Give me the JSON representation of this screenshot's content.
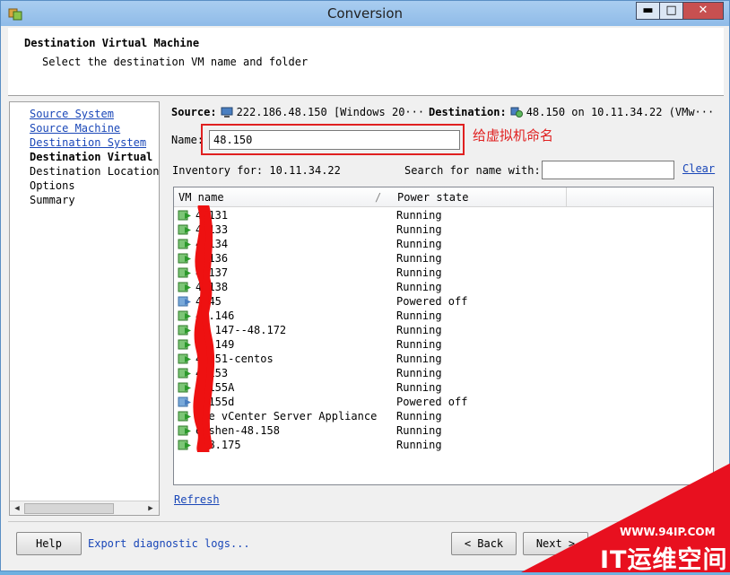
{
  "window": {
    "title": "Conversion",
    "controls": {
      "minimize": "▬",
      "maximize": "□",
      "close": "✕"
    }
  },
  "header": {
    "title": "Destination Virtual Machine",
    "subtitle": "Select the destination VM name and folder"
  },
  "steps": [
    {
      "label": "Source System",
      "state": "link"
    },
    {
      "label": "Source Machine",
      "state": "link"
    },
    {
      "label": "Destination System",
      "state": "link"
    },
    {
      "label": "Destination Virtual Machine",
      "state": "current"
    },
    {
      "label": "Destination Location",
      "state": "plain"
    },
    {
      "label": "Options",
      "state": "plain"
    },
    {
      "label": "Summary",
      "state": "plain"
    }
  ],
  "info": {
    "source_label": "Source:",
    "source_value": "222.186.48.150 [Windows 20···",
    "destination_label": "Destination:",
    "destination_value": "48.150 on 10.11.34.22 (VMw···"
  },
  "name_field": {
    "label": "Name:",
    "value": "48.150"
  },
  "annotation": "给虚拟机命名",
  "inventory": {
    "label": "Inventory for:",
    "value": "10.11.34.22"
  },
  "search": {
    "label": "Search for name with:",
    "value": "",
    "clear": "Clear"
  },
  "table": {
    "headers": {
      "name": "VM name",
      "state": "Power state",
      "sort": "/"
    },
    "rows": [
      {
        "name": "4 131",
        "state": "Running"
      },
      {
        "name": "4 133",
        "state": "Running"
      },
      {
        "name": "4 134",
        "state": "Running"
      },
      {
        "name": "4 136",
        "state": "Running"
      },
      {
        "name": "4 137",
        "state": "Running"
      },
      {
        "name": "4 138",
        "state": "Running"
      },
      {
        "name": "4 45",
        "state": "Powered off"
      },
      {
        "name": "48.146",
        "state": "Running"
      },
      {
        "name": "48 147--48.172",
        "state": "Running"
      },
      {
        "name": "48 149",
        "state": "Running"
      },
      {
        "name": "4 151-centos",
        "state": "Running"
      },
      {
        "name": "4 153",
        "state": "Running"
      },
      {
        "name": "4 155A",
        "state": "Running"
      },
      {
        "name": "4 155d",
        "state": "Powered off"
      },
      {
        "name": "are vCenter Server Appliance",
        "state": "Running"
      },
      {
        "name": "eishen-48.158",
        "state": "Running"
      },
      {
        "name": "-48.175",
        "state": "Running"
      }
    ]
  },
  "refresh": "Refresh",
  "footer": {
    "help": "Help",
    "diag": "Export diagnostic logs...",
    "back": "< Back",
    "next": "Next >"
  },
  "watermark": {
    "url": "WWW.94IP.COM",
    "text": "IT运维空间"
  },
  "colors": {
    "link": "#1a47b8",
    "annotation": "#e02020",
    "watermark": "#e8101f"
  }
}
